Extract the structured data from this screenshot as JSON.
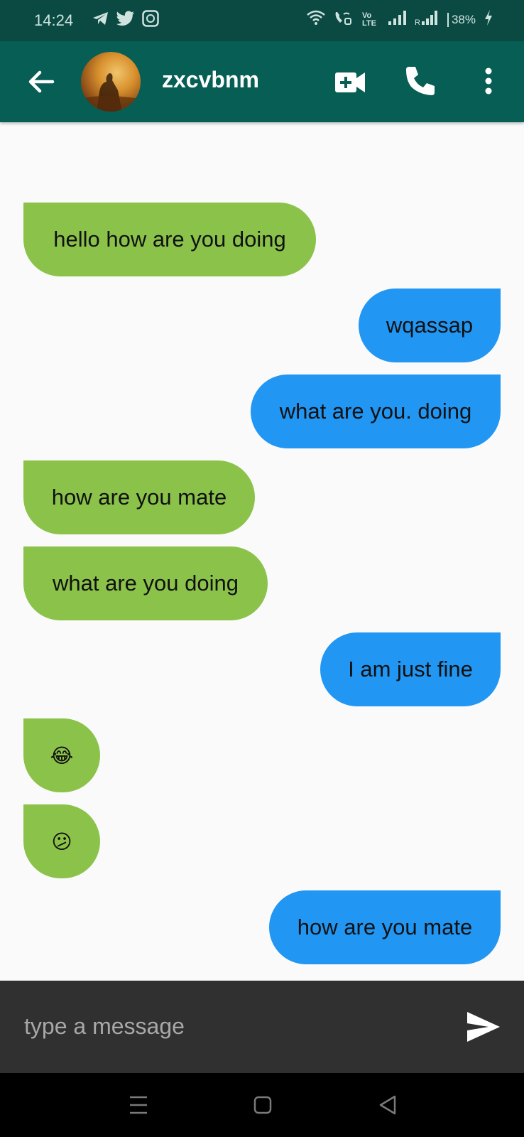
{
  "status_bar": {
    "time": "14:24",
    "left_icons": [
      "telegram-icon",
      "twitter-icon",
      "cb-app-icon"
    ],
    "right_icons": [
      "wifi-icon",
      "wifi-calling-icon",
      "volte-icon",
      "signal-icon",
      "signal-roaming-icon"
    ],
    "volte_label": "Vo LTE",
    "battery": "38%"
  },
  "app_bar": {
    "contact_name": "zxcvbnm",
    "color": "#075e54",
    "icons": [
      "back-arrow-icon",
      "video-call-icon",
      "phone-icon",
      "more-vert-icon"
    ]
  },
  "messages": [
    {
      "direction": "received",
      "text": "hello how are you doing"
    },
    {
      "direction": "sent",
      "text": "wqassap"
    },
    {
      "direction": "sent",
      "text": "what are you. doing"
    },
    {
      "direction": "received",
      "text": "how are you mate"
    },
    {
      "direction": "received",
      "text": "what are you doing"
    },
    {
      "direction": "sent",
      "text": "I am just fine"
    },
    {
      "direction": "received",
      "text": "😂"
    },
    {
      "direction": "received",
      "text": "😕"
    },
    {
      "direction": "sent",
      "text": "how are you mate"
    }
  ],
  "colors": {
    "received_bubble": "#8bc34a",
    "sent_bubble": "#2196f3",
    "input_bar": "#303030"
  },
  "input": {
    "placeholder": "type a message",
    "value": ""
  },
  "nav_bar": {
    "icons": [
      "recent-apps-icon",
      "home-icon",
      "back-triangle-icon"
    ]
  }
}
